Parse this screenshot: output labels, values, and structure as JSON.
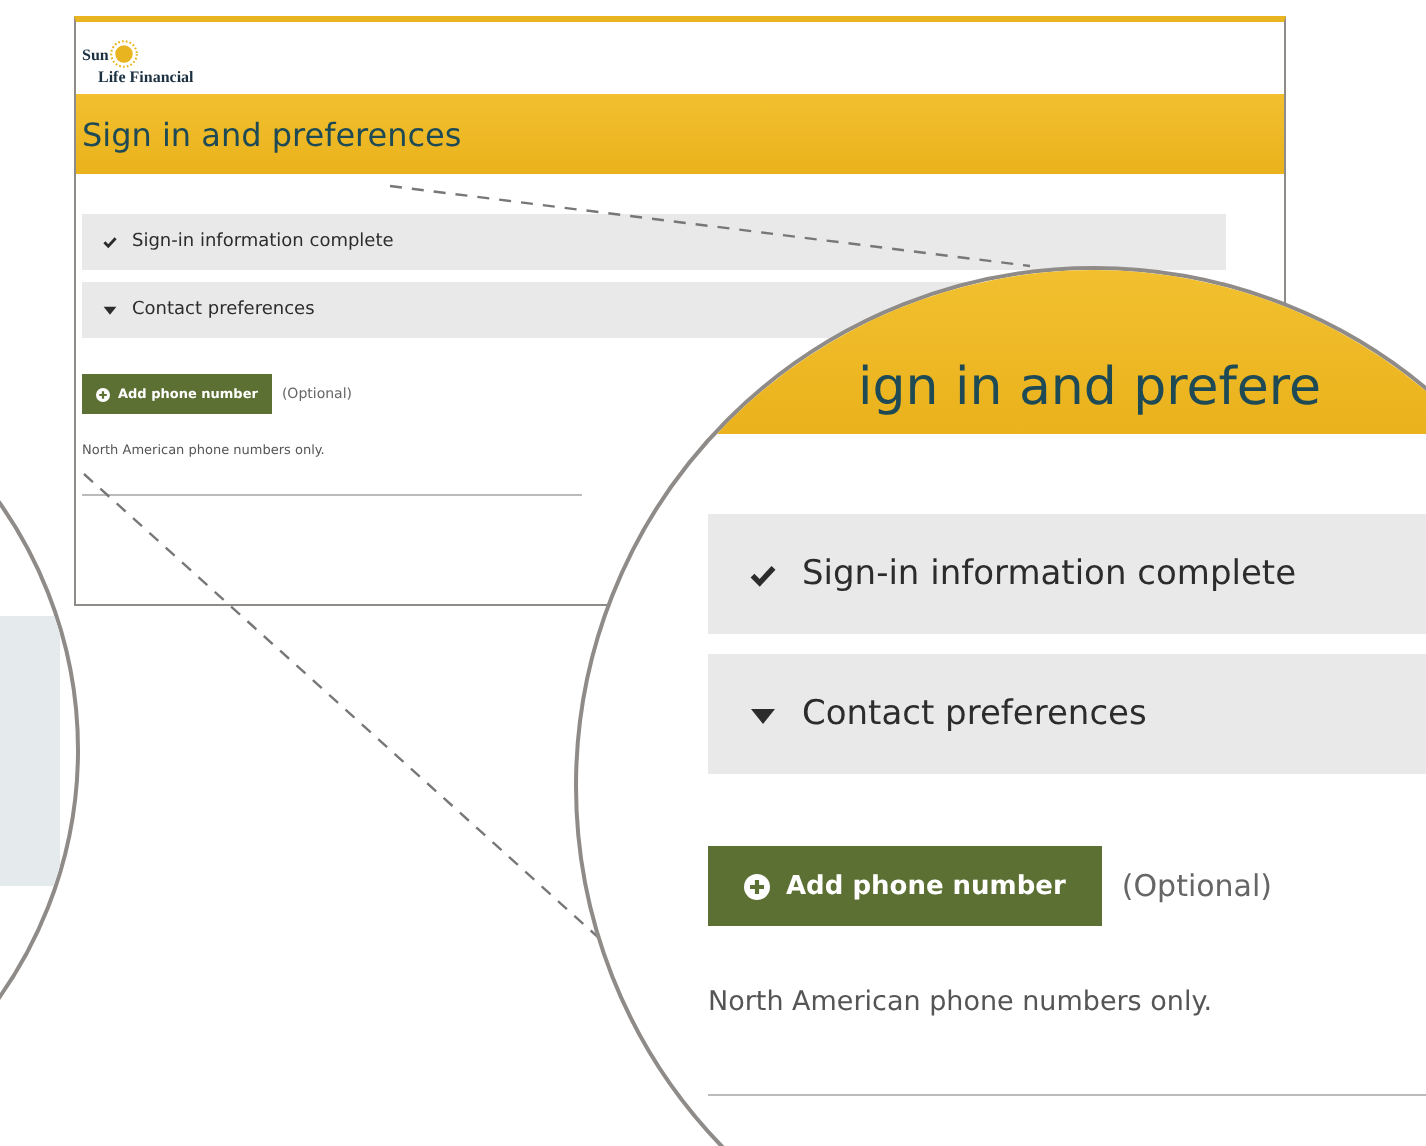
{
  "logo": {
    "line_1": "Sun",
    "line_2": "Life Financial"
  },
  "page_title": "Sign in and preferences",
  "sections": [
    {
      "label": "Sign-in information complete",
      "kind": "complete"
    },
    {
      "label": "Contact preferences",
      "kind": "expanded"
    }
  ],
  "add_button": "Add phone number",
  "optional_note": "(Optional)",
  "help_text": "North American phone numbers only.",
  "magnifier": {
    "page_title": "ign in and prefere",
    "sections": [
      {
        "label": "Sign-in information complete",
        "kind": "complete"
      },
      {
        "label": "Contact preferences",
        "kind": "expanded"
      }
    ],
    "add_button": "Add phone number",
    "optional_note": "(Optional)",
    "help_text": "North American phone numbers only."
  }
}
